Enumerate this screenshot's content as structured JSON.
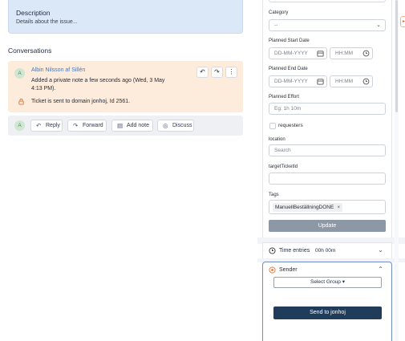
{
  "description": {
    "title": "Description",
    "placeholder": "Details about the issue..."
  },
  "conversations": {
    "title": "Conversations",
    "entry": {
      "avatar": "A",
      "author": "Albin Nilsson af Sillén",
      "note": "Added a private note a few seconds ago (Wed, 3 May 4:13 PM).",
      "domain_message": "Ticket is sent to domain jonhoj, Id 2561.",
      "icons": [
        "reply-icon",
        "forward-icon",
        "more-vertical-icon"
      ]
    },
    "actions": {
      "avatar": "A",
      "reply": "Reply",
      "forward": "Forward",
      "add_note": "Add note",
      "discuss": "Discuss"
    }
  },
  "sidebar": {
    "category": {
      "label": "Category",
      "value": "--"
    },
    "planned_start": {
      "label": "Planned Start Date",
      "date_placeholder": "DD-MM-YYYY",
      "time_placeholder": "HH:MM"
    },
    "planned_end": {
      "label": "Planned End Date",
      "date_placeholder": "DD-MM-YYYY",
      "time_placeholder": "HH:MM"
    },
    "planned_effort": {
      "label": "Planned Effort",
      "placeholder": "Eg: 1h 10m"
    },
    "requesters": {
      "label": "requesters"
    },
    "location": {
      "label": "location",
      "placeholder": "Search"
    },
    "target_ticket": {
      "label": "targetTicketId",
      "value": ""
    },
    "tags": {
      "label": "Tags",
      "items": [
        "ManuellBeställningDONE"
      ]
    },
    "update_button": "Update"
  },
  "time_entries": {
    "title": "Time entries",
    "value": "00h 00m"
  },
  "sender": {
    "title": "Sender",
    "group_select": "Select Group",
    "send_button": "Send to jonhoj"
  },
  "colors": {
    "description_bg": "#dbe8f8",
    "conversation_bg": "#fdebdc",
    "send_button": "#1f3c5a",
    "update_button": "#8d98a6",
    "author_link": "#4a78b5"
  }
}
